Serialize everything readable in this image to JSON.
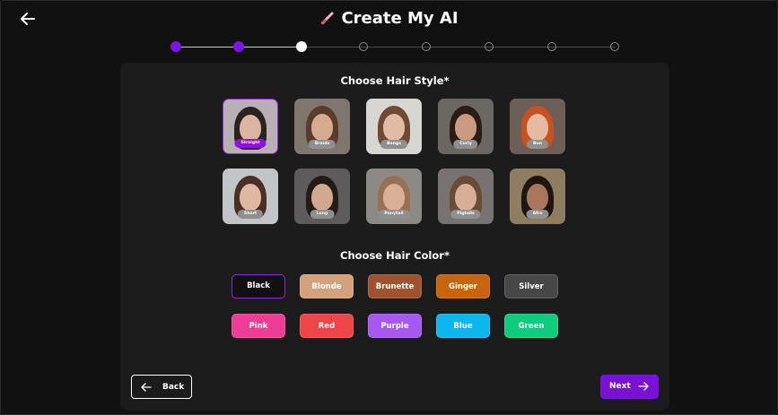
{
  "header": {
    "title": "Create My AI",
    "back_icon": "arrow-left-icon",
    "title_icon": "paintbrush-icon"
  },
  "stepper": {
    "total": 8,
    "completed": 2,
    "current": 3,
    "accent": "#7c15e5"
  },
  "hair_style": {
    "title": "Choose Hair Style*",
    "selected": "Straight",
    "options": [
      "Straight",
      "Braids",
      "Bangs",
      "Curly",
      "Bun",
      "Short",
      "Long",
      "Ponytail",
      "Pigtails",
      "Afro"
    ]
  },
  "hair_color": {
    "title": "Choose Hair Color*",
    "selected": "Black",
    "options": [
      {
        "label": "Black",
        "color": "#111111"
      },
      {
        "label": "Blonde",
        "color": "#d4a17d"
      },
      {
        "label": "Brunette",
        "color": "#a0532f"
      },
      {
        "label": "Ginger",
        "color": "#c8640c"
      },
      {
        "label": "Silver",
        "color": "#474747"
      },
      {
        "label": "Pink",
        "color": "#ee3d97"
      },
      {
        "label": "Red",
        "color": "#ee4548"
      },
      {
        "label": "Purple",
        "color": "#a858f2"
      },
      {
        "label": "Blue",
        "color": "#0cb6ef"
      },
      {
        "label": "Green",
        "color": "#0dcc7e"
      }
    ]
  },
  "footer": {
    "back_label": "Back",
    "next_label": "Next"
  }
}
